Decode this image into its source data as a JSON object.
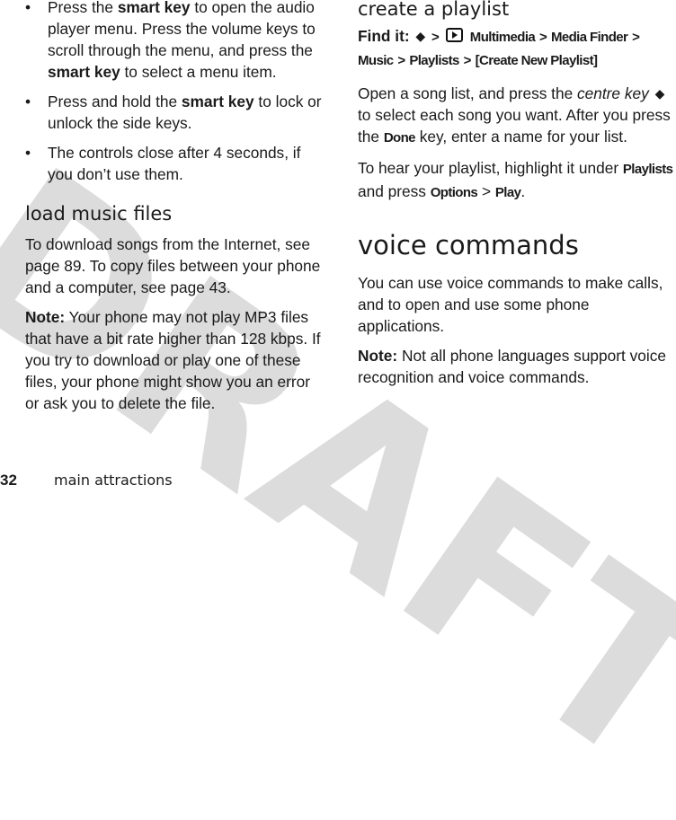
{
  "watermark": "DRAFT",
  "left_column": {
    "bullets": [
      {
        "parts": [
          {
            "t": "Press the "
          },
          {
            "t": "smart key",
            "b": true
          },
          {
            "t": " to open the audio player menu. Press the volume keys to scroll through the menu, and press the "
          },
          {
            "t": "smart key",
            "b": true
          },
          {
            "t": " to select a menu item."
          }
        ]
      },
      {
        "parts": [
          {
            "t": "Press and hold the "
          },
          {
            "t": "smart key",
            "b": true
          },
          {
            "t": " to lock or unlock the side keys."
          }
        ]
      },
      {
        "parts": [
          {
            "t": "The controls close after 4 seconds, if you don’t use them."
          }
        ]
      }
    ],
    "bullet_glyph": "•",
    "load_music": {
      "heading": "load music files",
      "para1": "To download songs from the Internet, see page 89. To copy files between your phone and a computer, see page 43.",
      "note_label": "Note:",
      "note_text": " Your phone may not play MP3 files that have a bit rate higher than 128 kbps. If you try to download or play one of these files, your phone might show you an error or ask you to delete the file."
    }
  },
  "right_column": {
    "create_playlist": {
      "heading": "create a playlist",
      "find_it_label": "Find it:",
      "nav_key_icon": "nav-key-icon",
      "media_icon": "multimedia-icon",
      "path_sep": ">",
      "path": [
        "Multimedia",
        "Media Finder",
        "Music",
        "Playlists",
        "[Create New Playlist]"
      ],
      "para1_a": "Open a song list, and press the ",
      "para1_italic": "centre key",
      "para1_b": " to select each song you want. After you press the ",
      "para1_done": "Done",
      "para1_c": " key, enter a name for your list.",
      "para2_a": "To hear your playlist, highlight it under ",
      "para2_playlists": "Playlists",
      "para2_b": " and press ",
      "para2_options": "Options",
      "para2_sep": " > ",
      "para2_play": "Play",
      "para2_end": "."
    },
    "voice_commands": {
      "heading": "voice commands",
      "para1": "You can use voice commands to make calls, and to open and use some phone applications.",
      "note_label": "Note:",
      "note_text": " Not all phone languages support voice recognition and voice commands."
    }
  },
  "footer": {
    "page_number": "32",
    "section_title": "main attractions"
  }
}
